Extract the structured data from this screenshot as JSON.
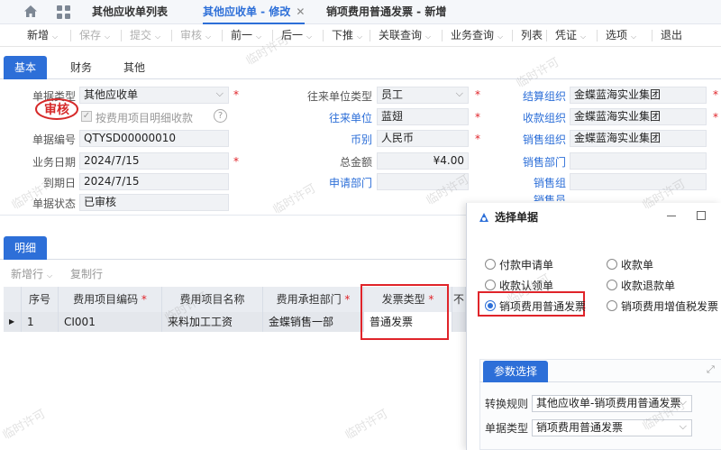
{
  "top_tabs": [
    {
      "label": "其他应收单列表",
      "active": false
    },
    {
      "label": "其他应收单 - 修改",
      "active": true
    },
    {
      "label": "销项费用普通发票 - 新增",
      "active": false
    }
  ],
  "tab_close": "✕",
  "toolbar": [
    {
      "label": "新增",
      "dropdown": true,
      "enabled": true
    },
    {
      "label": "保存",
      "dropdown": true,
      "enabled": false
    },
    {
      "label": "提交",
      "dropdown": true,
      "enabled": false
    },
    {
      "label": "审核",
      "dropdown": true,
      "enabled": false
    },
    {
      "label": "前一",
      "dropdown": true,
      "enabled": true
    },
    {
      "label": "后一",
      "dropdown": true,
      "enabled": true
    },
    {
      "label": "下推",
      "dropdown": true,
      "enabled": true
    },
    {
      "label": "关联查询",
      "dropdown": true,
      "enabled": true
    },
    {
      "label": "业务查询",
      "dropdown": true,
      "enabled": true
    },
    {
      "label": "列表",
      "dropdown": false,
      "enabled": true
    },
    {
      "label": "凭证",
      "dropdown": true,
      "enabled": true
    },
    {
      "label": "选项",
      "dropdown": true,
      "enabled": true
    },
    {
      "label": "退出",
      "dropdown": false,
      "enabled": true
    }
  ],
  "main_tabs": {
    "basic": "基本",
    "finance": "财务",
    "other": "其他"
  },
  "form": {
    "doc_type_label": "单据类型",
    "doc_type": "其他应收单",
    "stamp": "审核",
    "by_item_label": "按费用项目明细收款",
    "doc_no_label": "单据编号",
    "doc_no": "QTYSD00000010",
    "biz_date_label": "业务日期",
    "biz_date": "2024/7/15",
    "due_date_label": "到期日",
    "due_date": "2024/7/15",
    "status_label": "单据状态",
    "status": "已审核",
    "partner_type_label": "往来单位类型",
    "partner_type": "员工",
    "partner_label": "往来单位",
    "partner": "蓝翅",
    "currency_label": "币别",
    "currency": "人民币",
    "total_label": "总金额",
    "total": "¥4.00",
    "apply_dept_label": "申请部门",
    "settle_org_label": "结算组织",
    "settle_org": "金蝶蓝海实业集团",
    "receive_org_label": "收款组织",
    "receive_org": "金蝶蓝海实业集团",
    "sales_org_label": "销售组织",
    "sales_org": "金蝶蓝海实业集团",
    "sales_dept_label": "销售部门",
    "sales_group_label": "销售组",
    "sales_person_label": "销售员"
  },
  "detail": {
    "tab": "明细",
    "add_row": "新增行",
    "copy_row": "复制行",
    "columns": [
      "序号",
      "费用项目编码",
      "费用项目名称",
      "费用承担部门",
      "发票类型",
      "不"
    ],
    "required": [
      false,
      true,
      false,
      true,
      true,
      false
    ],
    "rows": [
      {
        "seq": "1",
        "code": "CI001",
        "name": "来料加工工资",
        "dept": "金蝶销售一部",
        "invoice_type": "普通发票"
      }
    ]
  },
  "dialog": {
    "title": "选择单据",
    "options": [
      {
        "label": "付款申请单",
        "selected": false
      },
      {
        "label": "收款单",
        "selected": false
      },
      {
        "label": "收款认领单",
        "selected": false
      },
      {
        "label": "收款退款单",
        "selected": false
      },
      {
        "label": "销项费用普通发票",
        "selected": true
      },
      {
        "label": "销项费用增值税发票",
        "selected": false
      }
    ],
    "params_tab": "参数选择",
    "rule_label": "转换规则",
    "rule": "其他应收单-销项费用普通发票",
    "doc_type_label": "单据类型",
    "doc_type": "销项费用普通发票"
  },
  "watermark": "临时许可",
  "colors": {
    "accent": "#2d6fd8",
    "required": "#e0242a",
    "highlight_border": "#e0242a"
  }
}
